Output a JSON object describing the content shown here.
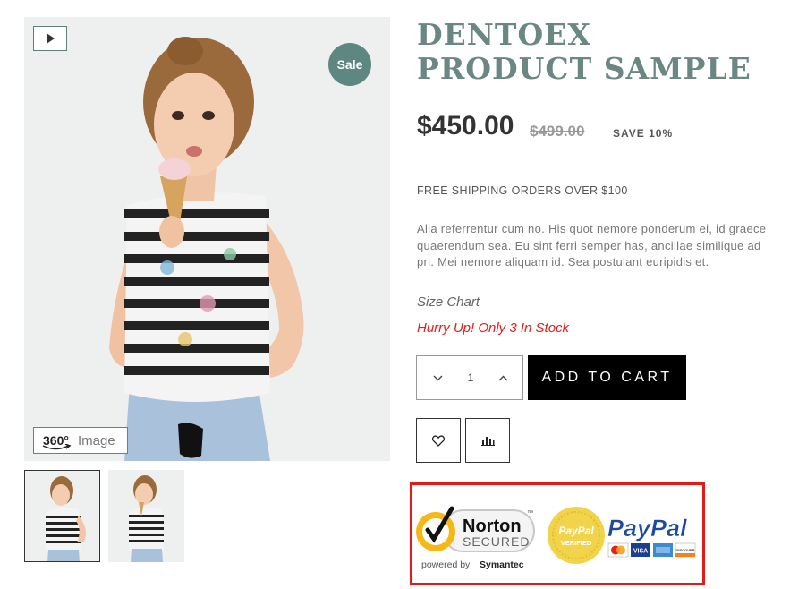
{
  "gallery": {
    "sale_badge": "Sale",
    "badge_360": "360°",
    "image_label": "Image",
    "icons": {
      "video": "play-icon",
      "rotate": "360-rotate-icon"
    }
  },
  "product": {
    "title": "DENTOEX PRODUCT SAMPLE",
    "price": "$450.00",
    "old_price": "$499.00",
    "save": "SAVE 10%",
    "shipping": "FREE SHIPPING ORDERS OVER $100",
    "description": "Alia referrentur cum no. His quot nemore ponderum ei, id graece quaerendum sea. Eu sint ferri semper has, ancillae similique ad pri. Mei nemore aliquam id. Sea postulant euripidis et.",
    "size_chart": "Size Chart",
    "stock_notice": "Hurry Up! Only 3 In Stock"
  },
  "cart": {
    "quantity": "1",
    "add_to_cart": "ADD TO CART",
    "icons": {
      "decrease": "chevron-down-icon",
      "increase": "chevron-up-icon",
      "wishlist": "heart-icon",
      "compare": "bar-chart-icon"
    }
  },
  "trust": {
    "norton_name": "Norton",
    "norton_secured": "SECURED",
    "norton_tm": "™",
    "norton_powered": "powered by",
    "norton_company": "Symantec",
    "paypal_seal_top": "PayPal",
    "paypal_seal_bottom": "VERIFIED",
    "paypal_logo": "PayPal",
    "card_visa": "VISA",
    "card_discover": "DISCOVER"
  },
  "colors": {
    "accent": "#5e8781",
    "title": "#6b8784",
    "stock_red": "#e0201e",
    "trust_border": "#e61919",
    "button": "#000000"
  }
}
